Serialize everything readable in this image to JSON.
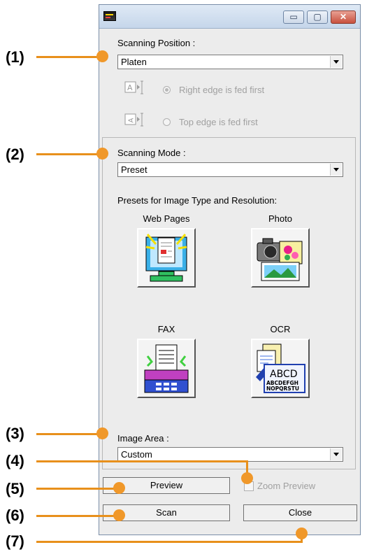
{
  "callouts": [
    "(1)",
    "(2)",
    "(3)",
    "(4)",
    "(5)",
    "(6)",
    "(7)"
  ],
  "window": {
    "icon": "twain-icon",
    "controls": {
      "minimize": "▭",
      "maximize": "▢",
      "close": "✕"
    }
  },
  "scanning_position": {
    "label": "Scanning Position :",
    "value": "Platen",
    "options": [
      {
        "label": "Right edge is fed first",
        "checked": true,
        "enabled": false
      },
      {
        "label": "Top edge is fed first",
        "checked": false,
        "enabled": false
      }
    ]
  },
  "scanning_mode": {
    "label": "Scanning Mode :",
    "value": "Preset",
    "presets_heading": "Presets for Image Type and Resolution:",
    "presets": [
      {
        "label": "Web Pages",
        "icon": "web-pages-icon"
      },
      {
        "label": "Photo",
        "icon": "photo-icon"
      },
      {
        "label": "FAX",
        "icon": "fax-icon"
      },
      {
        "label": "OCR",
        "icon": "ocr-icon",
        "icon_text_1": "ABCD",
        "icon_text_2": "ABCDEFGH",
        "icon_text_3": "NOPQRSTU"
      }
    ]
  },
  "image_area": {
    "label": "Image Area :",
    "value": "Custom"
  },
  "buttons": {
    "preview": "Preview",
    "scan": "Scan",
    "close": "Close"
  },
  "zoom_preview": {
    "label": "Zoom Preview",
    "checked": false,
    "enabled": false
  },
  "colors": {
    "callout_orange": "#f0982a",
    "title_bar": "#cfdcec",
    "close_button": "#c8513f"
  }
}
